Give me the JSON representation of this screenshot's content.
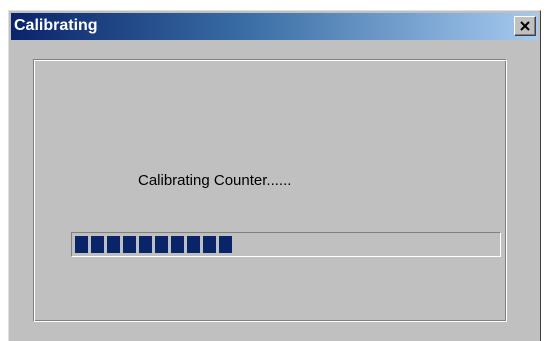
{
  "window": {
    "title": "Calibrating"
  },
  "titlebar_buttons": {
    "close_icon": "close-x-icon"
  },
  "dialog": {
    "status_text": "Calibrating Counter......",
    "progress": {
      "fraction": 0.4,
      "segments_filled": 10,
      "fill_color": "#0a246a"
    }
  },
  "colors": {
    "face": "#c0c0c0",
    "title_active_start": "#0a246a",
    "title_active_end": "#a6caf0"
  }
}
